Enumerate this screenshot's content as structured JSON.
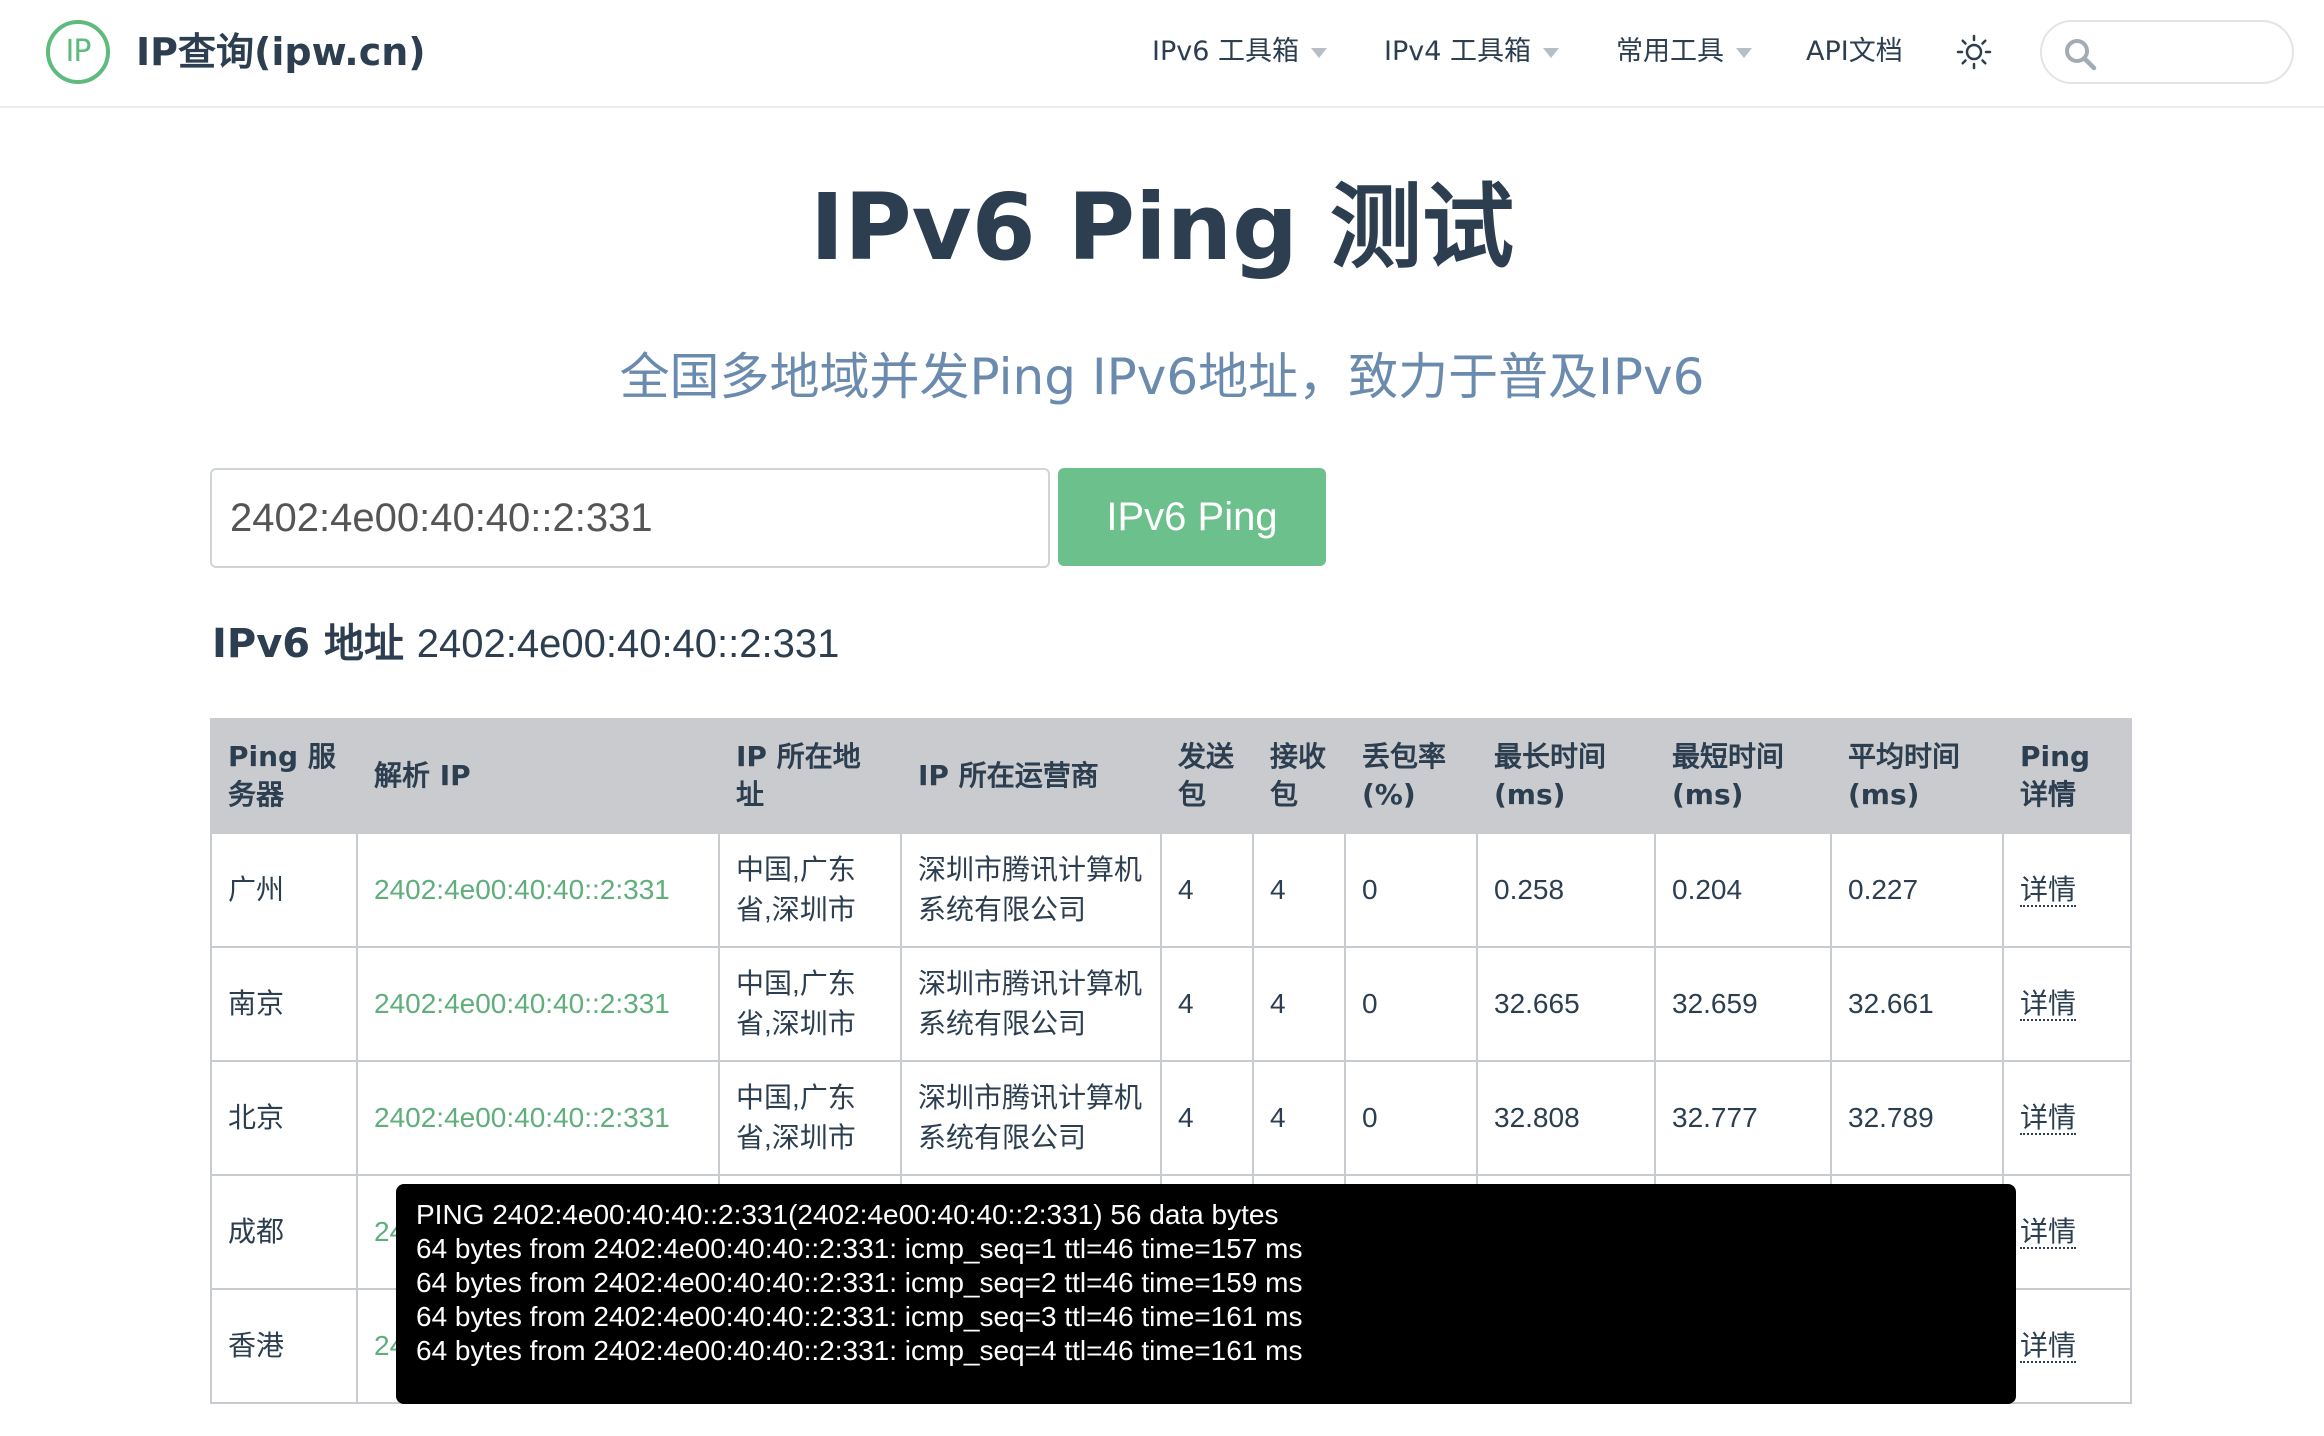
{
  "header": {
    "logo_text": "IP",
    "site_title": "IP查询(ipw.cn)",
    "nav": [
      {
        "label": "IPv6 工具箱",
        "has_caret": true
      },
      {
        "label": "IPv4 工具箱",
        "has_caret": true
      },
      {
        "label": "常用工具",
        "has_caret": true
      },
      {
        "label": "API文档",
        "has_caret": false
      }
    ],
    "theme_icon": "sun-icon",
    "search_icon": "search-icon",
    "search_placeholder": ""
  },
  "hero": {
    "title": "IPv6 Ping 测试",
    "subtitle": "全国多地域并发Ping IPv6地址，致力于普及IPv6"
  },
  "form": {
    "input_value": "2402:4e00:40:40::2:331",
    "button_label": "IPv6 Ping"
  },
  "address": {
    "label": "IPv6 地址",
    "value": "2402:4e00:40:40::2:331"
  },
  "colors": {
    "accent": "#5fbb7d",
    "button": "#6cc08c",
    "subtitle": "#6a8bad",
    "table_header": "#c9cbcf"
  },
  "table": {
    "headers": [
      "Ping 服务器",
      "解析 IP",
      "IP 所在地址",
      "IP 所在运营商",
      "发送包",
      "接收包",
      "丢包率 (%)",
      "最长时间 (ms)",
      "最短时间 (ms)",
      "平均时间 (ms)",
      "Ping详情"
    ],
    "rows": [
      {
        "server": "广州",
        "ip": "2402:4e00:40:40::2:331",
        "location": "中国,广东省,深圳市",
        "isp": "深圳市腾讯计算机系统有限公司",
        "sent": "4",
        "received": "4",
        "loss": "0",
        "max": "0.258",
        "min": "0.204",
        "avg": "0.227",
        "detail": "详情"
      },
      {
        "server": "南京",
        "ip": "2402:4e00:40:40::2:331",
        "location": "中国,广东省,深圳市",
        "isp": "深圳市腾讯计算机系统有限公司",
        "sent": "4",
        "received": "4",
        "loss": "0",
        "max": "32.665",
        "min": "32.659",
        "avg": "32.661",
        "detail": "详情"
      },
      {
        "server": "北京",
        "ip": "2402:4e00:40:40::2:331",
        "location": "中国,广东省,深圳市",
        "isp": "深圳市腾讯计算机系统有限公司",
        "sent": "4",
        "received": "4",
        "loss": "0",
        "max": "32.808",
        "min": "32.777",
        "avg": "32.789",
        "detail": "详情"
      },
      {
        "server": "成都",
        "ip": "24",
        "location": "",
        "isp": "",
        "sent": "",
        "received": "",
        "loss": "",
        "max": "",
        "min": "",
        "avg": "",
        "detail": "详情"
      },
      {
        "server": "香港",
        "ip": "24",
        "location": "",
        "isp": "",
        "sent": "",
        "received": "",
        "loss": "",
        "max": "",
        "min": "",
        "avg": "",
        "detail": "详情"
      }
    ]
  },
  "popup": {
    "lines": [
      "PING 2402:4e00:40:40::2:331(2402:4e00:40:40::2:331) 56 data bytes",
      "64 bytes from 2402:4e00:40:40::2:331: icmp_seq=1 ttl=46 time=157 ms",
      "64 bytes from 2402:4e00:40:40::2:331: icmp_seq=2 ttl=46 time=159 ms",
      "64 bytes from 2402:4e00:40:40::2:331: icmp_seq=3 ttl=46 time=161 ms",
      "64 bytes from 2402:4e00:40:40::2:331: icmp_seq=4 ttl=46 time=161 ms"
    ]
  }
}
